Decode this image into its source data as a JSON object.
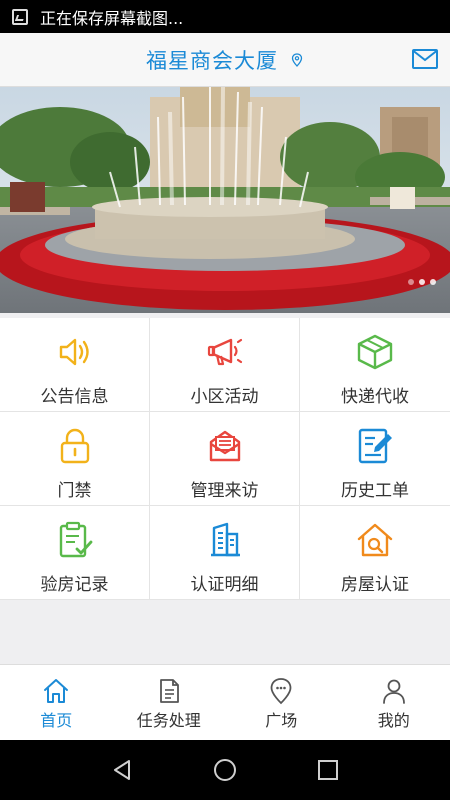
{
  "status_bar": {
    "notification_text": "正在保存屏幕截图..."
  },
  "header": {
    "title": "福星商会大厦"
  },
  "banner": {
    "slide_count": 3,
    "active_slide": 1
  },
  "grid": [
    {
      "label": "公告信息",
      "icon": "speaker-icon",
      "color": "#f2b21a"
    },
    {
      "label": "小区活动",
      "icon": "megaphone-icon",
      "color": "#e8463e"
    },
    {
      "label": "快递代收",
      "icon": "package-icon",
      "color": "#59b94a"
    },
    {
      "label": "门禁",
      "icon": "lock-icon",
      "color": "#f2b21a"
    },
    {
      "label": "管理来访",
      "icon": "envelope-icon",
      "color": "#e8463e"
    },
    {
      "label": "历史工单",
      "icon": "edit-document-icon",
      "color": "#1b8ad6"
    },
    {
      "label": "验房记录",
      "icon": "clipboard-check-icon",
      "color": "#59b94a"
    },
    {
      "label": "认证明细",
      "icon": "building-icon",
      "color": "#1b8ad6"
    },
    {
      "label": "房屋认证",
      "icon": "house-verify-icon",
      "color": "#f08a1c"
    }
  ],
  "tabs": [
    {
      "label": "首页",
      "icon": "home-icon",
      "active": true
    },
    {
      "label": "任务处理",
      "icon": "document-icon",
      "active": false
    },
    {
      "label": "广场",
      "icon": "location-chat-icon",
      "active": false
    },
    {
      "label": "我的",
      "icon": "user-icon",
      "active": false
    }
  ],
  "colors": {
    "accent": "#1b8ad6",
    "text": "#333333",
    "background": "#efeff1"
  }
}
